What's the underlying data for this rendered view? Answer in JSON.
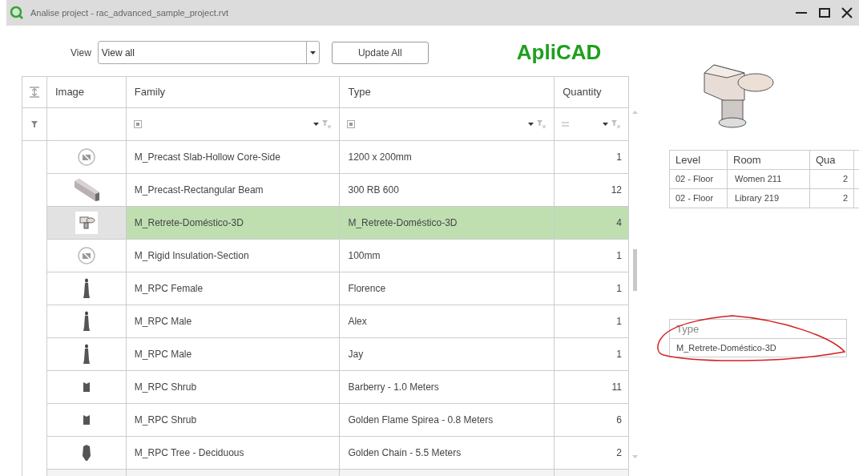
{
  "window": {
    "title": "Analise project - rac_advanced_sample_project.rvt"
  },
  "toolbar": {
    "view_label": "View",
    "view_value": "View all",
    "update_button": "Update All",
    "logo": "ApliCAD"
  },
  "table": {
    "columns": [
      "Image",
      "Family",
      "Type",
      "Quantity"
    ],
    "rows": [
      {
        "kind": "none",
        "family": "M_Precast Slab-Hollow Core-Side",
        "type": "1200 x 200mm",
        "quantity": "1",
        "selected": false
      },
      {
        "kind": "beam",
        "family": "M_Precast-Rectangular Beam",
        "type": "300 RB 600",
        "quantity": "12",
        "selected": false
      },
      {
        "kind": "toilet",
        "family": "M_Retrete-Doméstico-3D",
        "type": "M_Retrete-Doméstico-3D",
        "quantity": "4",
        "selected": true
      },
      {
        "kind": "none",
        "family": "M_Rigid Insulation-Section",
        "type": "100mm",
        "quantity": "1",
        "selected": false
      },
      {
        "kind": "person",
        "family": "M_RPC Female",
        "type": "Florence",
        "quantity": "1",
        "selected": false
      },
      {
        "kind": "person",
        "family": "M_RPC Male",
        "type": "Alex",
        "quantity": "1",
        "selected": false
      },
      {
        "kind": "person",
        "family": "M_RPC Male",
        "type": "Jay",
        "quantity": "1",
        "selected": false
      },
      {
        "kind": "shrub",
        "family": "M_RPC Shrub",
        "type": "Barberry - 1.0 Meters",
        "quantity": "11",
        "selected": false
      },
      {
        "kind": "shrub",
        "family": "M_RPC Shrub",
        "type": "Golden Flame Spirea - 0.8 Meters",
        "quantity": "6",
        "selected": false
      },
      {
        "kind": "tree",
        "family": "M_RPC Tree - Deciduous",
        "type": "Golden Chain - 5.5 Meters",
        "quantity": "2",
        "selected": false
      }
    ]
  },
  "instances": {
    "columns": [
      "Level",
      "Room",
      "Qua"
    ],
    "rows": [
      {
        "level": "02 - Floor",
        "room": "Women 211",
        "quantity": "2"
      },
      {
        "level": "02 - Floor",
        "room": "Library 219",
        "quantity": "2"
      }
    ]
  },
  "type_table": {
    "column": "Type",
    "value": "M_Retrete-Doméstico-3D"
  }
}
